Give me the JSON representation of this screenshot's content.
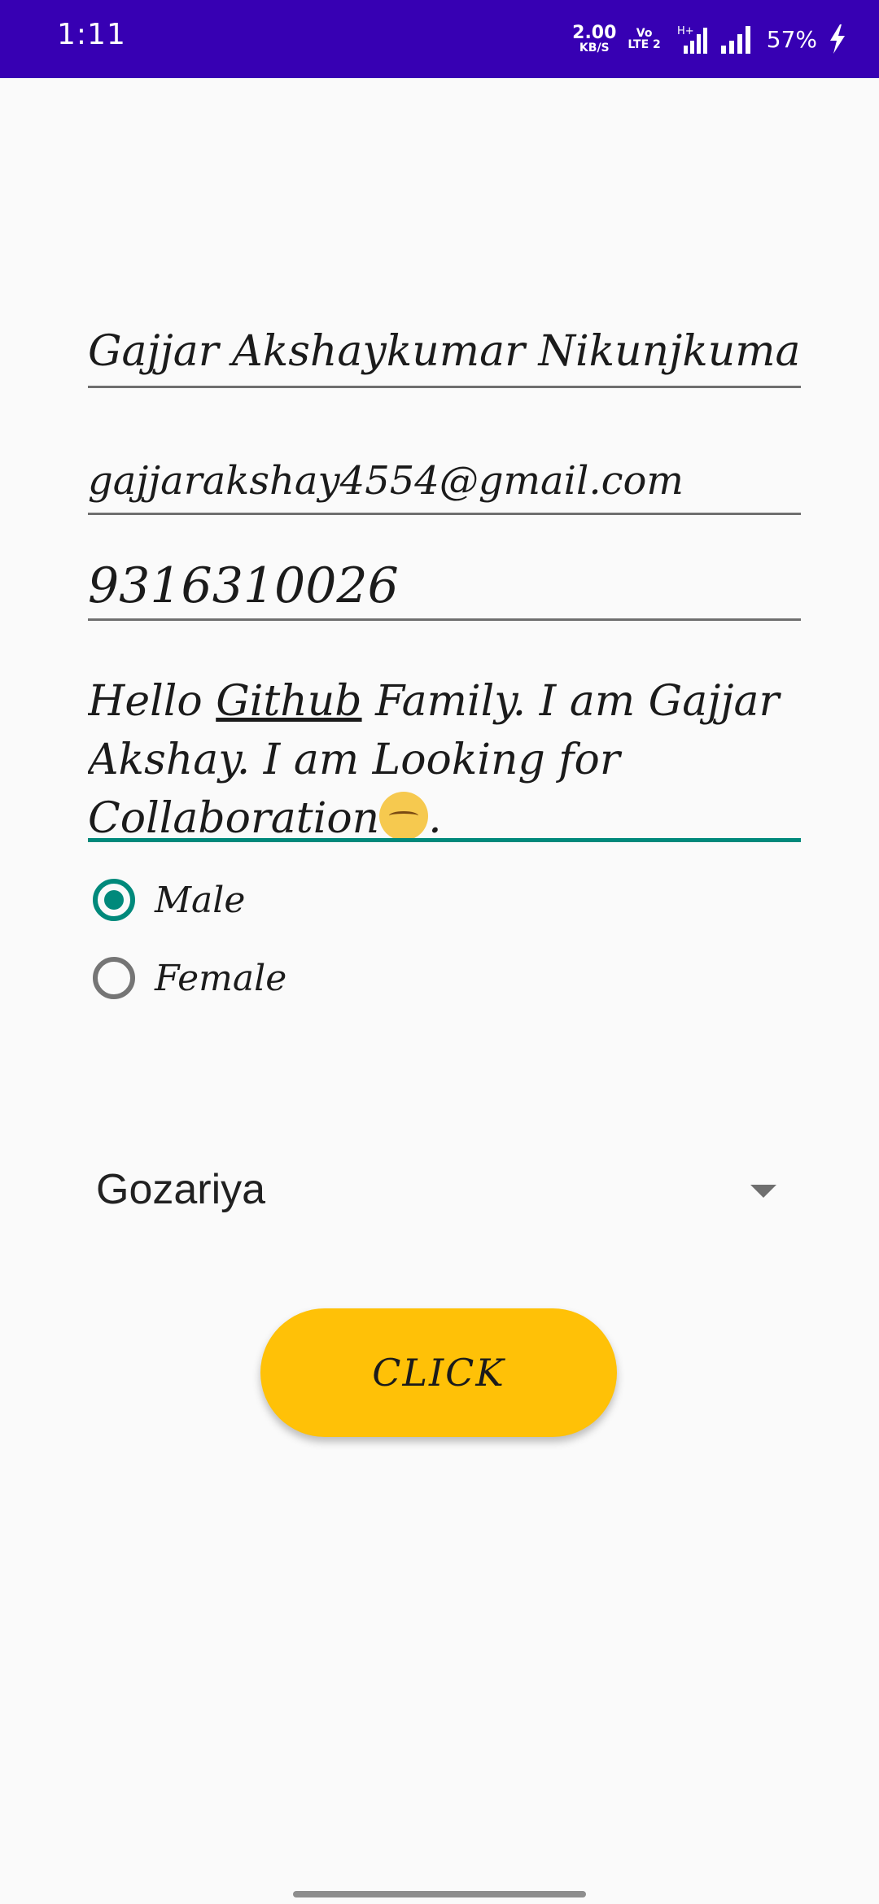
{
  "status_bar": {
    "time": "1:11",
    "net_speed_value": "2.00",
    "net_speed_unit": "KB/S",
    "volte_top": "Vo",
    "volte_bottom": "LTE 2",
    "network_type": "H+",
    "battery": "57%",
    "icons": [
      "signal-icon",
      "signal-icon",
      "charging-icon"
    ]
  },
  "form": {
    "name": "Gajjar Akshaykumar Nikunjkumar",
    "email": "gajjarakshay4554@gmail.com",
    "phone": "9316310026",
    "about": {
      "part1": "Hello ",
      "underlined": "Github",
      "part2": " Family. I am Gajjar Akshay. I am Looking for Collaboration",
      "emoji": "smiling-face-icon",
      "end": "."
    },
    "gender_options": [
      {
        "label": "Male",
        "checked": true
      },
      {
        "label": "Female",
        "checked": false
      }
    ],
    "city_selected": "Gozariya",
    "button_label": "CLICK"
  },
  "colors": {
    "status_bar": "#3700b3",
    "accent": "#00897b",
    "button": "#ffc107",
    "background": "#fafafa"
  }
}
